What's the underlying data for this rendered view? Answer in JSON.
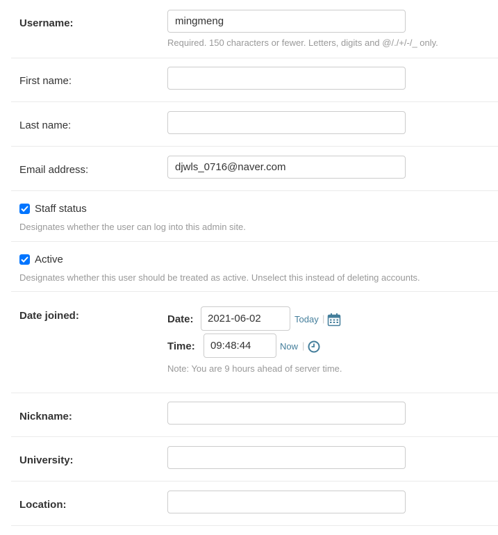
{
  "username": {
    "label": "Username:",
    "value": "mingmeng",
    "help": "Required. 150 characters or fewer. Letters, digits and @/./+/-/_ only."
  },
  "first_name": {
    "label": "First name:",
    "value": ""
  },
  "last_name": {
    "label": "Last name:",
    "value": ""
  },
  "email": {
    "label": "Email address:",
    "value": "djwls_0716@naver.com"
  },
  "staff_status": {
    "label": "Staff status",
    "checked": true,
    "help": "Designates whether the user can log into this admin site."
  },
  "active": {
    "label": "Active",
    "checked": true,
    "help": "Designates whether this user should be treated as active. Unselect this instead of deleting accounts."
  },
  "date_joined": {
    "label": "Date joined:",
    "date_label": "Date:",
    "date_value": "2021-06-02",
    "today_link": "Today",
    "time_label": "Time:",
    "time_value": "09:48:44",
    "now_link": "Now",
    "separator": "|",
    "note": "Note: You are 9 hours ahead of server time.",
    "calendar_icon": "calendar-icon",
    "clock_icon": "clock-icon"
  },
  "nickname": {
    "label": "Nickname:",
    "value": ""
  },
  "university": {
    "label": "University:",
    "value": ""
  },
  "location": {
    "label": "Location:",
    "value": ""
  },
  "colors": {
    "link": "#447e9b",
    "checkbox": "#0075ff",
    "help_text": "#999999",
    "border": "#cccccc"
  }
}
